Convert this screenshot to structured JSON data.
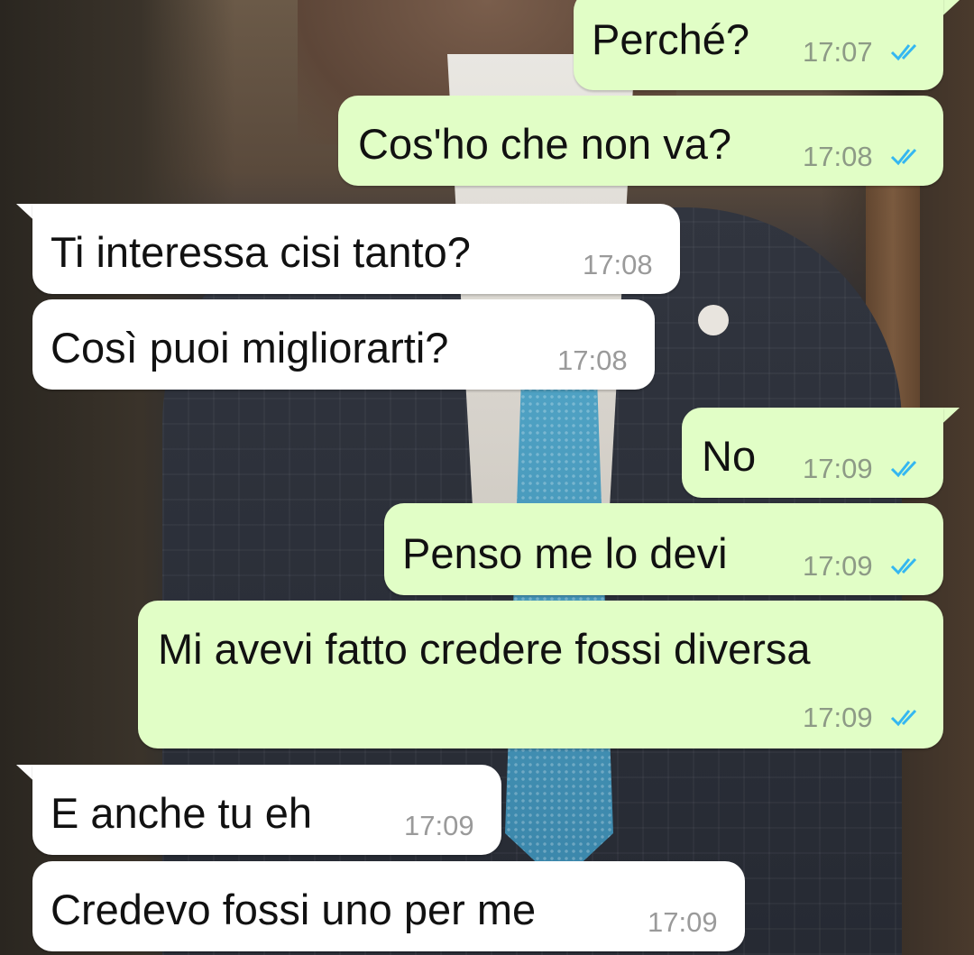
{
  "messages": [
    {
      "direction": "outgoing",
      "text": "Perché?",
      "time": "17:07",
      "status": "read"
    },
    {
      "direction": "outgoing",
      "text": "Cos'ho che non va?",
      "time": "17:08",
      "status": "read"
    },
    {
      "direction": "incoming",
      "text": "Ti interessa cisi tanto?",
      "time": "17:08"
    },
    {
      "direction": "incoming",
      "text": "Così puoi migliorarti?",
      "time": "17:08"
    },
    {
      "direction": "outgoing",
      "text": "No",
      "time": "17:09",
      "status": "read"
    },
    {
      "direction": "outgoing",
      "text": "Penso me lo devi",
      "time": "17:09",
      "status": "read"
    },
    {
      "direction": "outgoing",
      "text": "Mi avevi fatto credere fossi diversa",
      "time": "17:09",
      "status": "read"
    },
    {
      "direction": "incoming",
      "text": "E anche tu eh",
      "time": "17:09"
    },
    {
      "direction": "incoming",
      "text": "Credevo fossi uno per me",
      "time": "17:09"
    }
  ],
  "colors": {
    "outgoing_bubble": "#e1fec6",
    "incoming_bubble": "#ffffff",
    "read_ticks": "#34b7f1"
  },
  "icons": {
    "read_status": "double-check-icon"
  }
}
